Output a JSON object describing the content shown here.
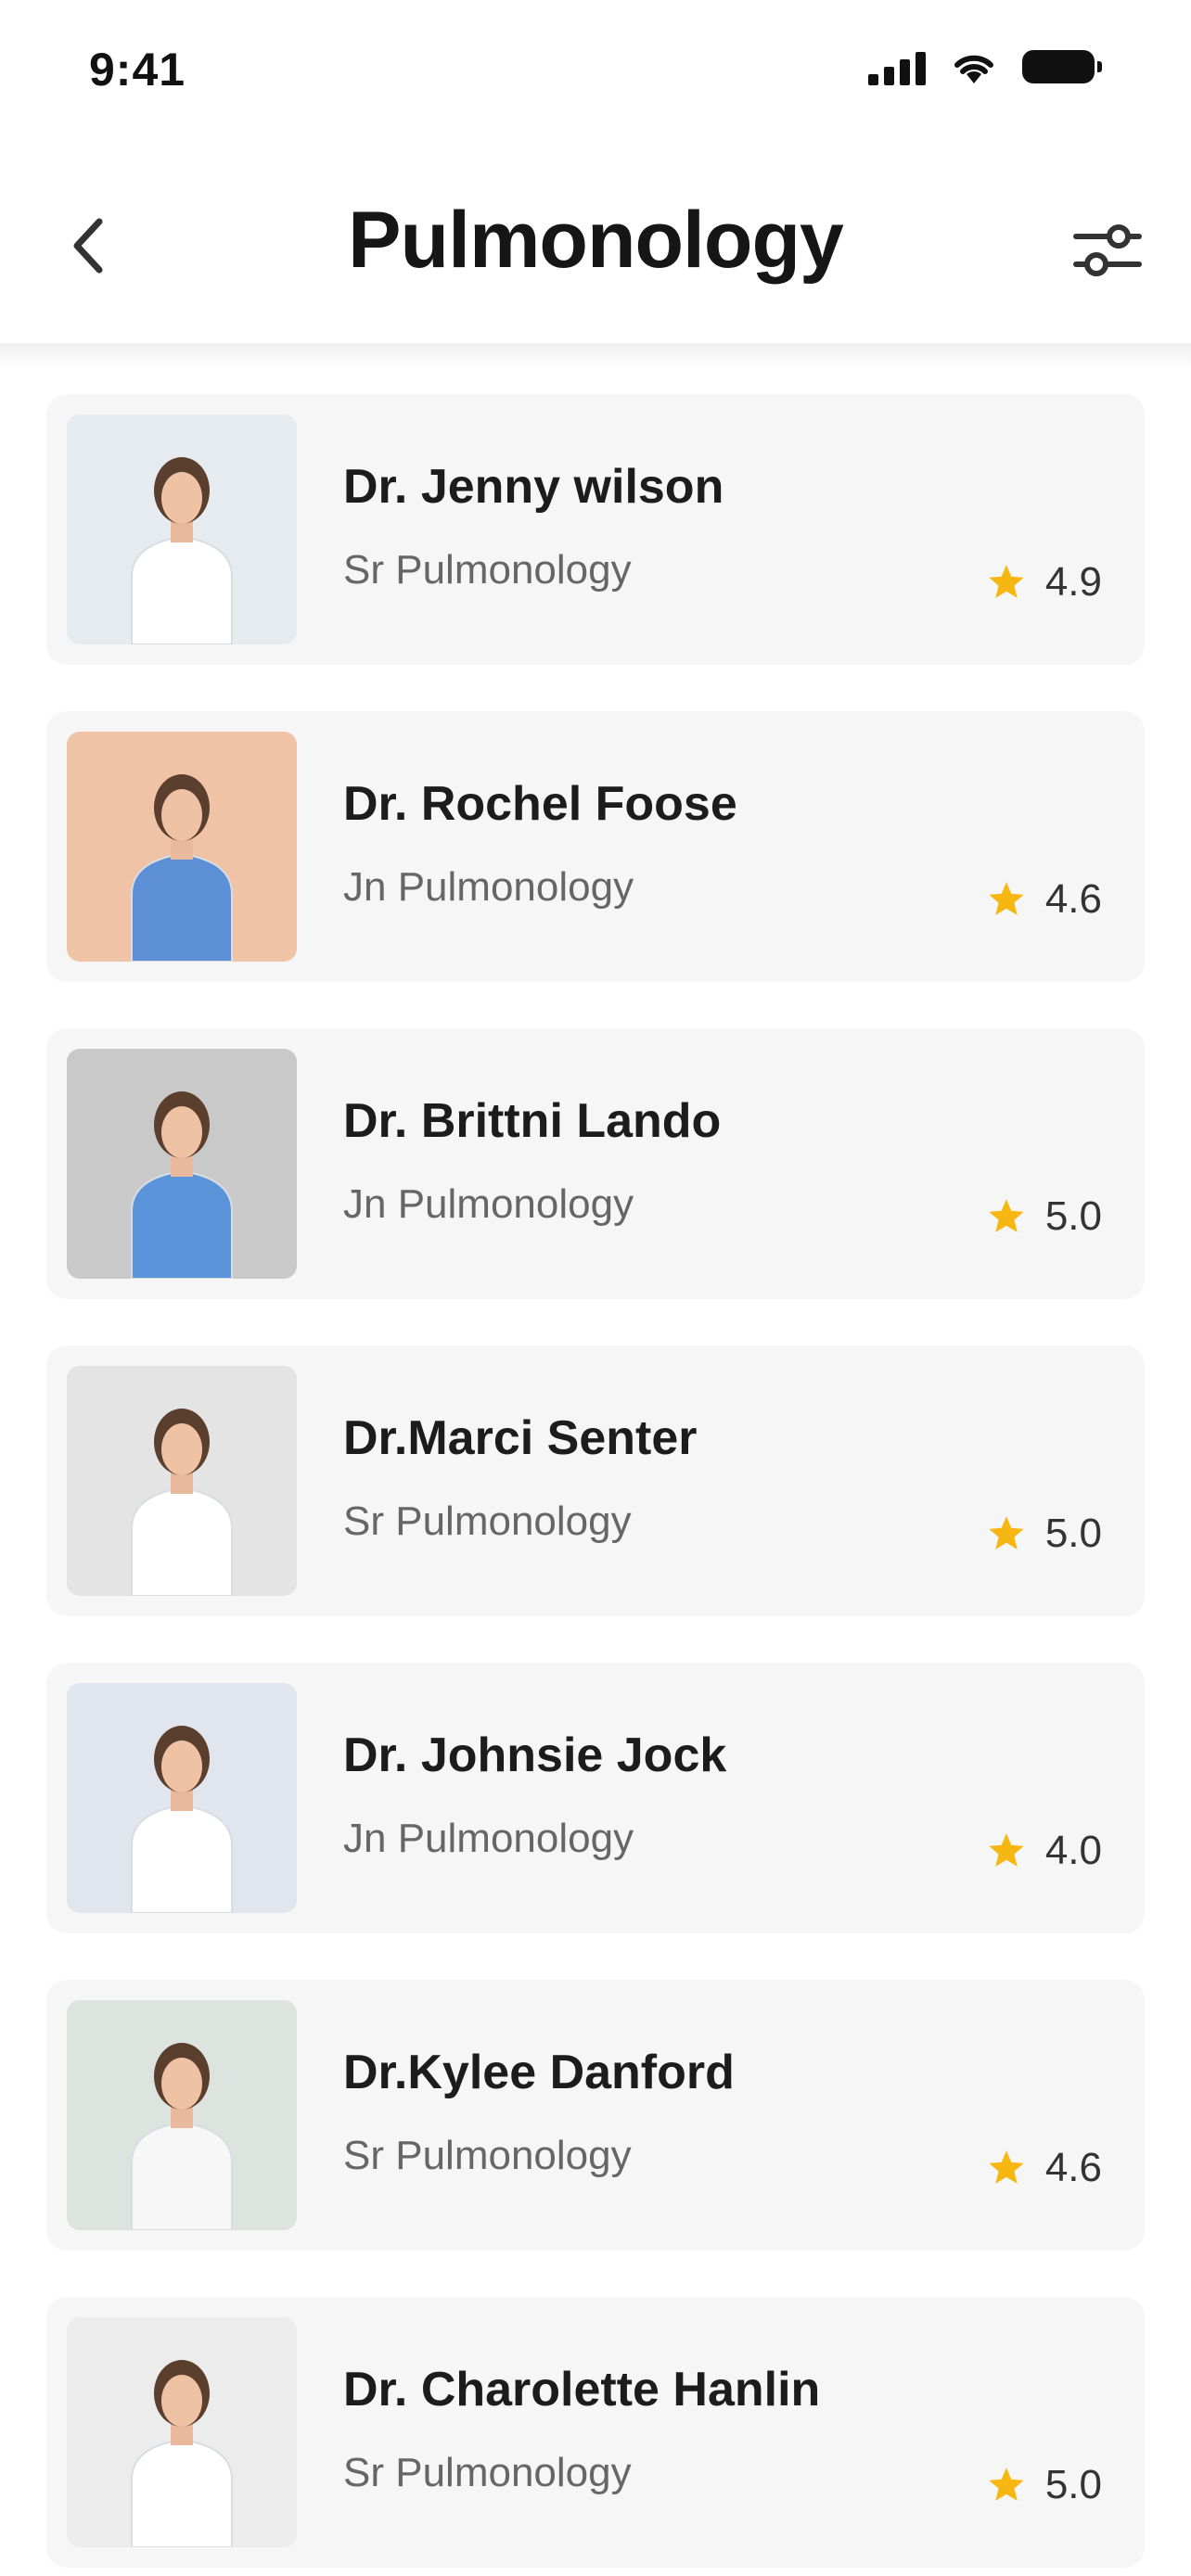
{
  "status_bar": {
    "time": "9:41"
  },
  "header": {
    "title": "Pulmonology"
  },
  "colors": {
    "star": "#f6b712",
    "card_bg": "#f6f6f6"
  },
  "doctors": [
    {
      "name": "Dr. Jenny wilson",
      "role": "Sr Pulmonology",
      "rating": "4.9",
      "photo_bg": "#e6ebef",
      "coat": "#ffffff"
    },
    {
      "name": "Dr. Rochel Foose",
      "role": "Jn Pulmonology",
      "rating": "4.6",
      "photo_bg": "#f0c2a6",
      "coat": "#5d8fd6"
    },
    {
      "name": "Dr. Brittni Lando",
      "role": "Jn Pulmonology",
      "rating": "5.0",
      "photo_bg": "#c9c9c9",
      "coat": "#5b94da"
    },
    {
      "name": "Dr.Marci Senter",
      "role": "Sr Pulmonology",
      "rating": "5.0",
      "photo_bg": "#e4e4e4",
      "coat": "#ffffff"
    },
    {
      "name": "Dr. Johnsie Jock",
      "role": "Jn Pulmonology",
      "rating": "4.0",
      "photo_bg": "#e1e6ee",
      "coat": "#ffffff"
    },
    {
      "name": "Dr.Kylee Danford",
      "role": "Sr Pulmonology",
      "rating": "4.6",
      "photo_bg": "#dde3df",
      "coat": "#f7f7f7"
    },
    {
      "name": "Dr. Charolette Hanlin",
      "role": "Sr Pulmonology",
      "rating": "5.0",
      "photo_bg": "#ececec",
      "coat": "#ffffff"
    }
  ]
}
